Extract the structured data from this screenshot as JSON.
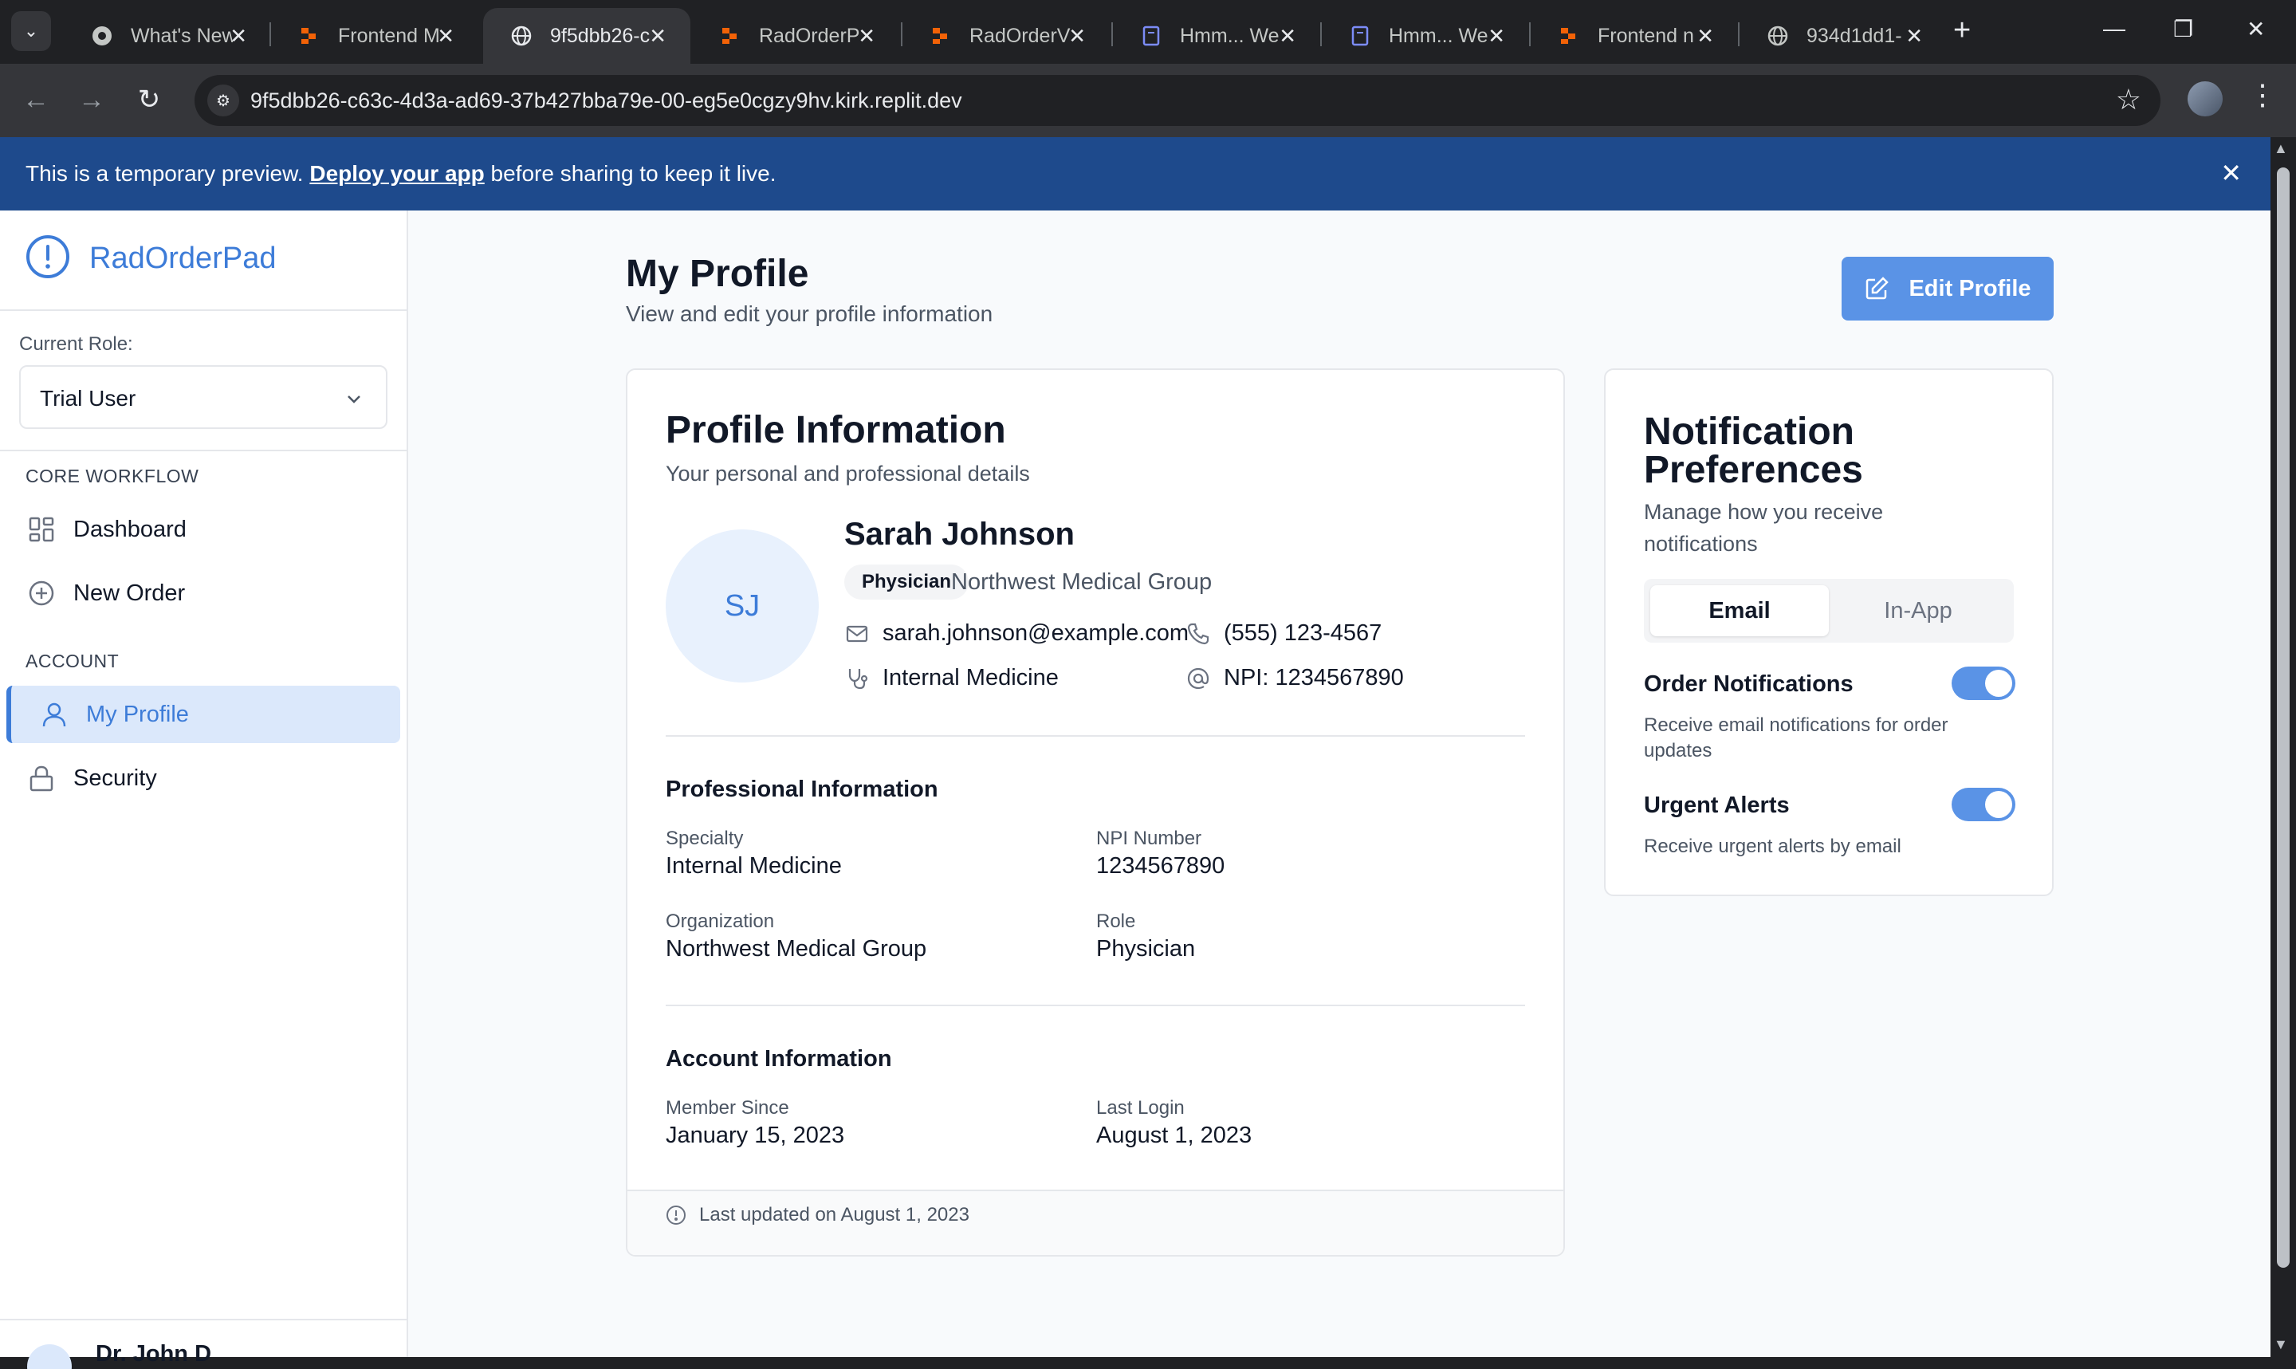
{
  "browser": {
    "tabs": [
      {
        "title": "What's New",
        "icon": "chrome-icon"
      },
      {
        "title": "Frontend M",
        "icon": "replit-icon"
      },
      {
        "title": "9f5dbb26-c",
        "icon": "globe-icon"
      },
      {
        "title": "RadOrderP",
        "icon": "replit-icon"
      },
      {
        "title": "RadOrderV",
        "icon": "replit-icon"
      },
      {
        "title": "Hmm... We",
        "icon": "doc-icon"
      },
      {
        "title": "Hmm... We",
        "icon": "doc-icon"
      },
      {
        "title": "Frontend n",
        "icon": "replit-icon"
      },
      {
        "title": "934d1dd1-",
        "icon": "globe-icon"
      }
    ],
    "active_tab_index": 2,
    "url": "9f5dbb26-c63c-4d3a-ad69-37b427bba79e-00-eg5e0cgzy9hv.kirk.replit.dev"
  },
  "banner": {
    "text_before": "This is a temporary preview.",
    "link": "Deploy your app",
    "text_after": "before sharing to keep it live."
  },
  "sidebar": {
    "brand": "RadOrderPad",
    "current_role_label": "Current Role:",
    "current_role": "Trial User",
    "sections": [
      {
        "label": "CORE WORKFLOW",
        "items": [
          {
            "label": "Dashboard",
            "icon": "dashboard-icon"
          },
          {
            "label": "New Order",
            "icon": "plus-circle-icon"
          }
        ]
      },
      {
        "label": "ACCOUNT",
        "items": [
          {
            "label": "My Profile",
            "icon": "user-icon",
            "active": true
          },
          {
            "label": "Security",
            "icon": "lock-icon"
          }
        ]
      }
    ],
    "user_name": "Dr. John D"
  },
  "page": {
    "title": "My Profile",
    "subtitle": "View and edit your profile information",
    "edit_button": "Edit Profile"
  },
  "profile": {
    "title": "Profile Information",
    "subtitle": "Your personal and professional details",
    "initials": "SJ",
    "name": "Sarah Johnson",
    "role_badge": "Physician",
    "organization": "Northwest Medical Group",
    "email": "sarah.johnson@example.com",
    "phone": "(555) 123-4567",
    "specialty": "Internal Medicine",
    "npi_inline": "NPI: 1234567890",
    "professional": {
      "title": "Professional Information",
      "specialty_label": "Specialty",
      "specialty_value": "Internal Medicine",
      "npi_label": "NPI Number",
      "npi_value": "1234567890",
      "org_label": "Organization",
      "org_value": "Northwest Medical Group",
      "role_label": "Role",
      "role_value": "Physician"
    },
    "account": {
      "title": "Account Information",
      "member_label": "Member Since",
      "member_value": "January 15, 2023",
      "login_label": "Last Login",
      "login_value": "August 1, 2023"
    },
    "footer": "Last updated on August 1, 2023"
  },
  "notifications": {
    "title_line1": "Notification",
    "title_line2": "Preferences",
    "subtitle_line1": "Manage how you receive",
    "subtitle_line2": "notifications",
    "tabs": [
      "Email",
      "In-App"
    ],
    "active_tab": "Email",
    "prefs": [
      {
        "title": "Order Notifications",
        "desc": "Receive email notifications for order updates",
        "enabled": true
      },
      {
        "title": "Urgent Alerts",
        "desc": "Receive urgent alerts by email",
        "enabled": true
      }
    ]
  },
  "colors": {
    "accent": "#3d7cd8",
    "button": "#5a93e6",
    "banner": "#1e4a8c",
    "active_nav_bg": "#dbe8fb"
  }
}
